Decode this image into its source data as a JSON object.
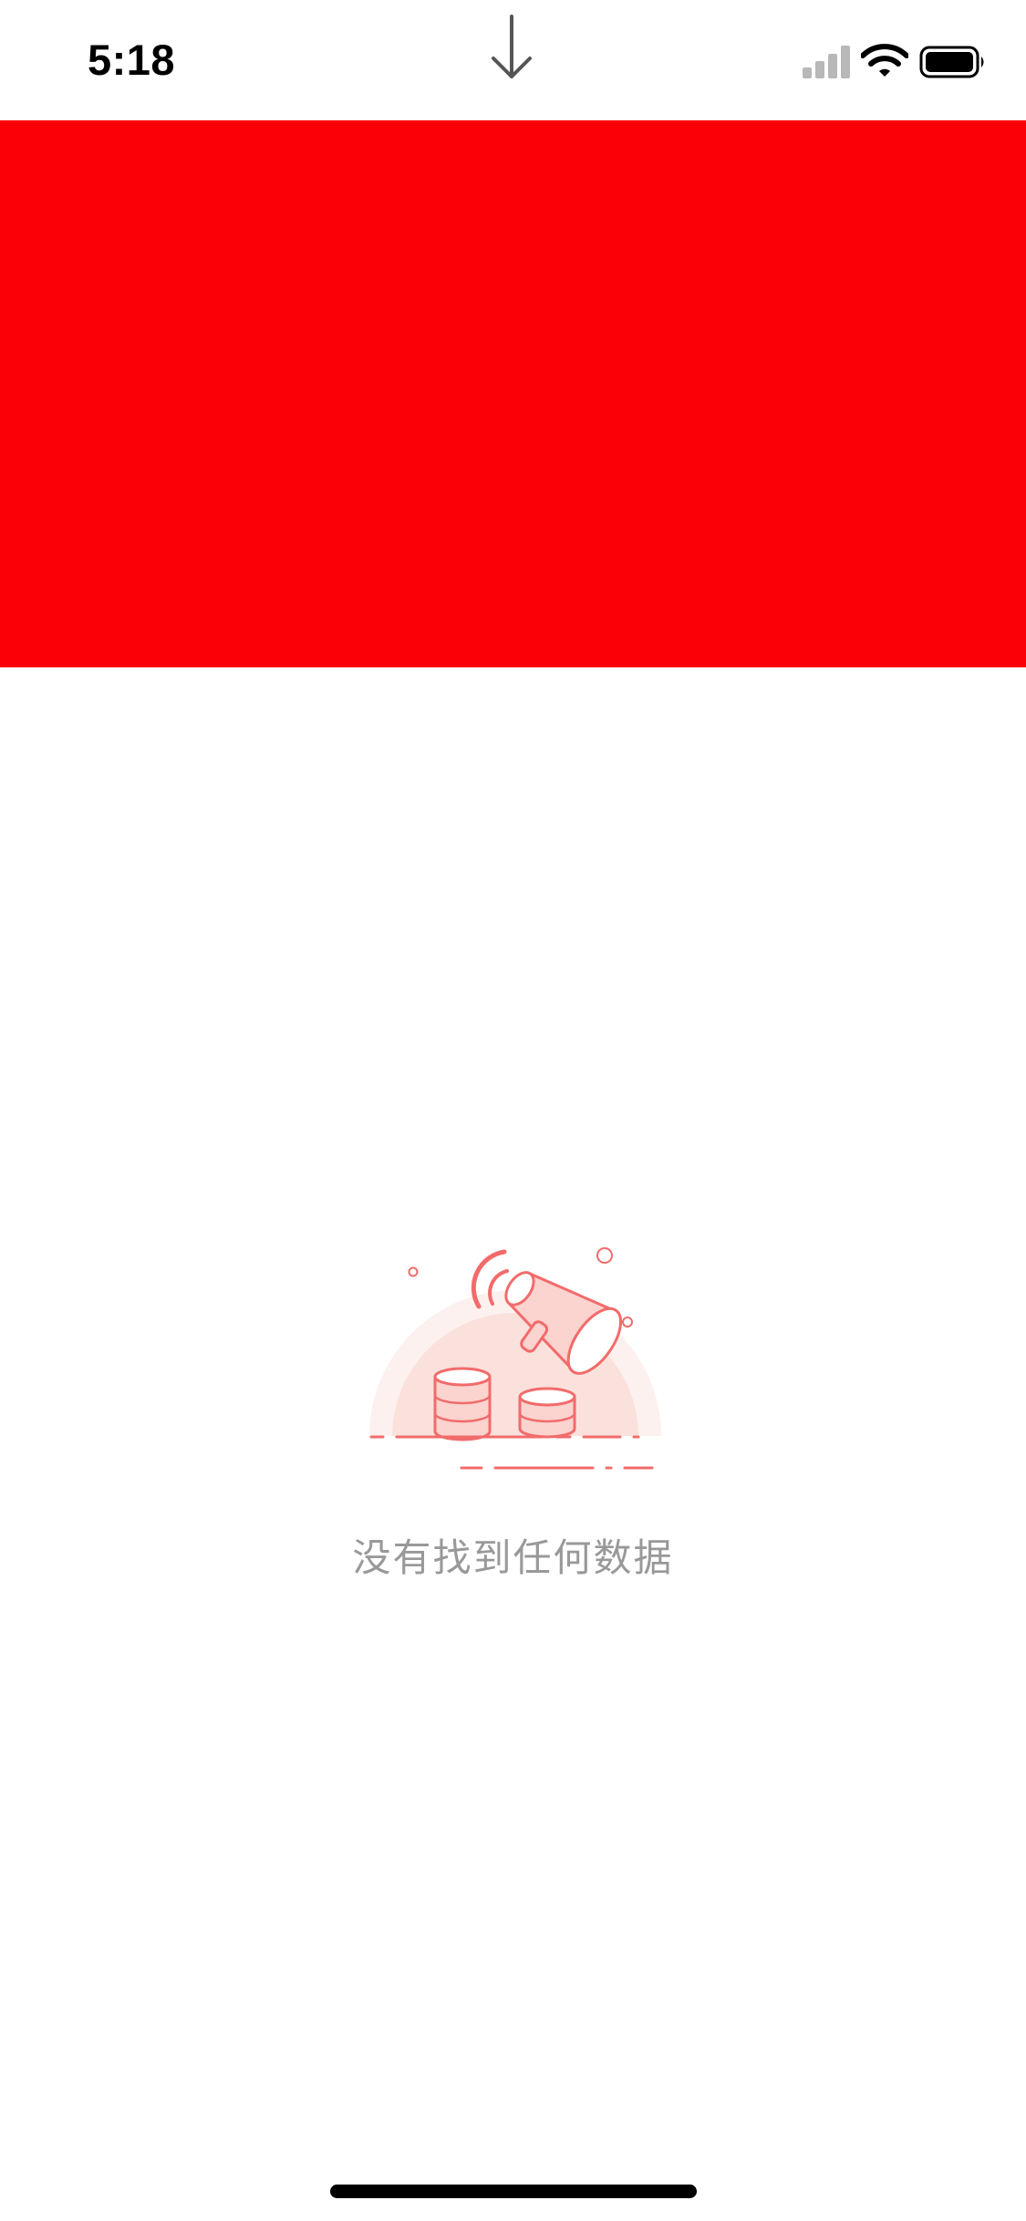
{
  "status_bar": {
    "time": "5:18",
    "signal_icon": "cellular-signal-icon",
    "wifi_icon": "wifi-icon",
    "battery_icon": "battery-icon"
  },
  "pull_indicator": {
    "icon": "arrow-down-icon"
  },
  "banner": {
    "color": "#fc0007"
  },
  "empty_state": {
    "illustration": "megaphone-coins-empty-icon",
    "message": "没有找到任何数据",
    "accent_color": "#f26b6b"
  }
}
